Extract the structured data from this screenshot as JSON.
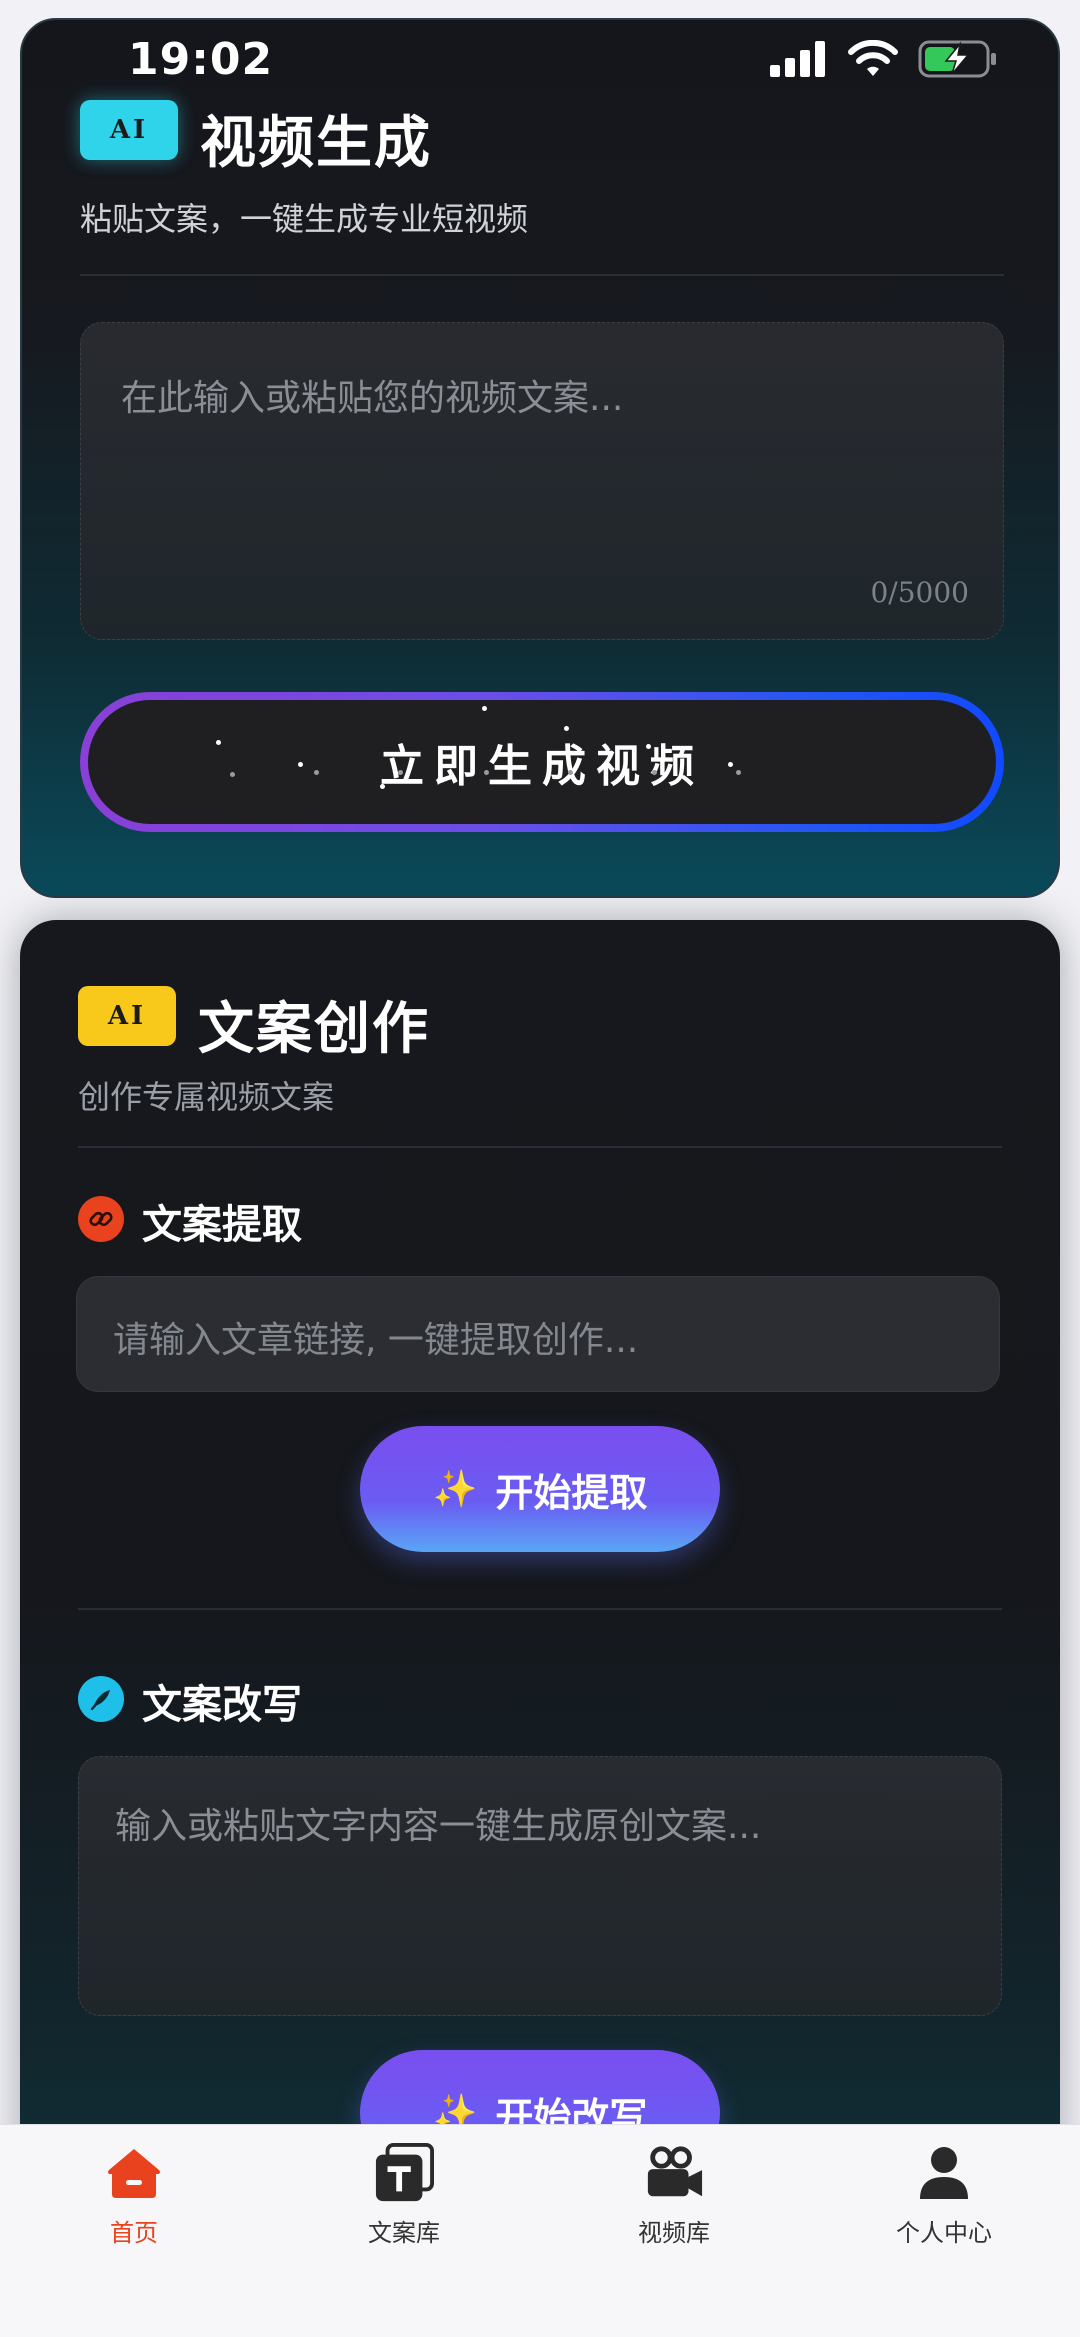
{
  "status_bar": {
    "time": "19:02"
  },
  "video_card": {
    "badge": "AI",
    "title": "视频生成",
    "subtitle": "粘贴文案，一键生成专业短视频",
    "textarea_placeholder": "在此输入或粘贴您的视频文案...",
    "char_count": "0/5000",
    "generate_button": "立即生成视频"
  },
  "copy_card": {
    "badge": "AI",
    "title": "文案创作",
    "subtitle": "创作专属视频文案",
    "extract": {
      "label": "文案提取",
      "placeholder": "请输入文章链接, 一键提取创作...",
      "button": "开始提取"
    },
    "rewrite": {
      "label": "文案改写",
      "placeholder": "输入或粘贴文字内容一键生成原创文案...",
      "button": "开始改写"
    }
  },
  "tab_bar": {
    "items": [
      {
        "label": "首页",
        "icon": "home-icon",
        "active": true
      },
      {
        "label": "文案库",
        "icon": "text-library-icon",
        "active": false
      },
      {
        "label": "视频库",
        "icon": "video-camera-icon",
        "active": false
      },
      {
        "label": "个人中心",
        "icon": "person-icon",
        "active": false
      }
    ]
  },
  "colors": {
    "accent_active": "#e8421e",
    "badge_cyan": "#2fd3ea",
    "badge_yellow": "#f8c91a",
    "button_gradient_start": "#8a3fd6",
    "button_gradient_end": "#1149ff"
  }
}
